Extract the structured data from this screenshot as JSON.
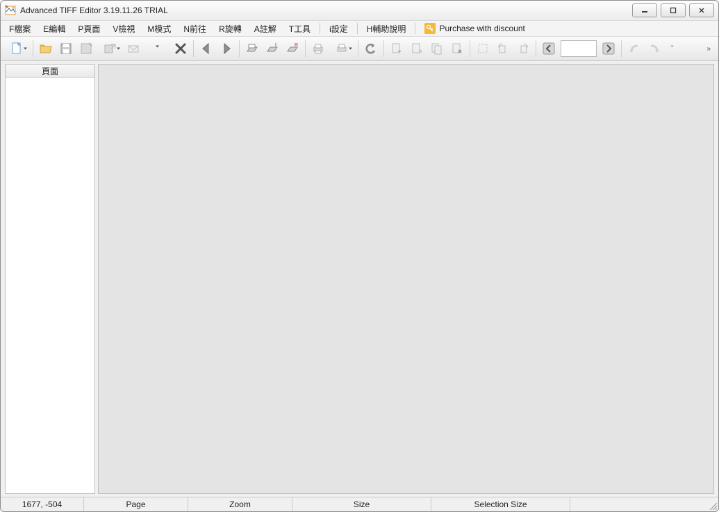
{
  "window": {
    "title": "Advanced TIFF Editor 3.19.11.26 TRIAL"
  },
  "menu": {
    "items": [
      "F檔案",
      "E編輯",
      "P頁面",
      "V檢視",
      "M模式",
      "N前往",
      "R旋轉",
      "A註解",
      "T工具",
      "i設定",
      "H輔助說明"
    ],
    "purchase_label": "Purchase with discount"
  },
  "toolbar": {
    "page_value": ""
  },
  "sidebar": {
    "header": "頁面"
  },
  "statusbar": {
    "coord": "1677, -504",
    "page_label": "Page",
    "zoom_label": "Zoom",
    "size_label": "Size",
    "selection_label": "Selection Size"
  },
  "icons": {
    "app": "app-icon",
    "minimize": "minimize-icon",
    "maximize": "maximize-icon",
    "close": "close-icon",
    "new": "new-icon",
    "open": "open-icon",
    "save": "save-icon",
    "save_as": "save-as-icon",
    "export": "export-icon",
    "mail": "mail-icon",
    "delete": "delete-icon",
    "prev": "prev-icon",
    "next": "next-icon",
    "scan": "scan-icon",
    "scan_insert": "scan-insert-icon",
    "scan_replace": "scan-replace-icon",
    "print": "print-icon",
    "print_all": "print-all-icon",
    "undo": "undo-icon",
    "page_add": "page-add-icon",
    "page_insert": "page-insert-icon",
    "page_replace": "page-replace-icon",
    "page_del": "page-delete-icon",
    "crop": "crop-icon",
    "rotate_left": "rotate-left-icon",
    "rotate_right": "rotate-right-icon",
    "page_prev": "page-prev-icon",
    "page_next": "page-next-icon",
    "redo_l": "curved-left-icon",
    "redo_r": "curved-right-icon",
    "overflow": "overflow-icon"
  }
}
